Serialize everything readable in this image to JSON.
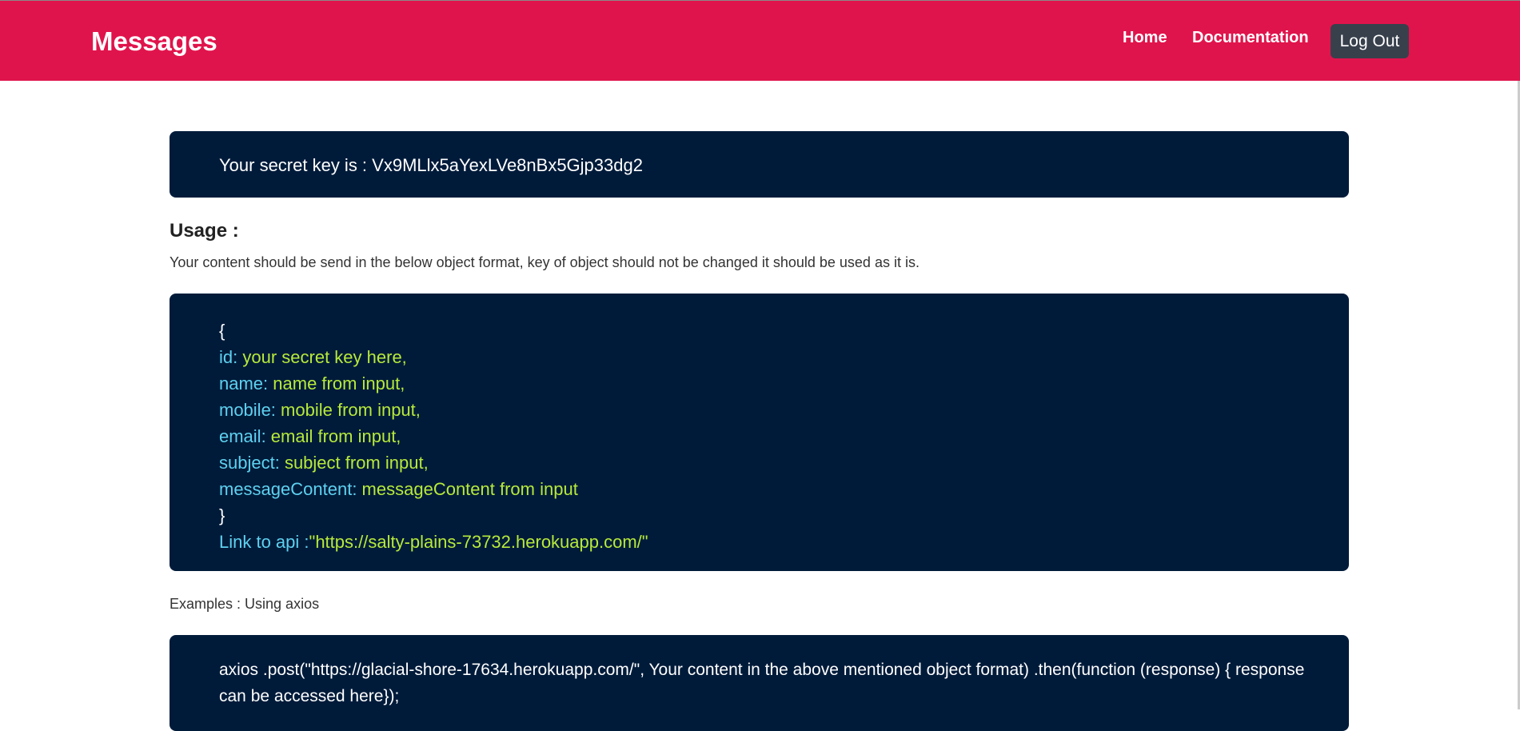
{
  "nav": {
    "brand": "Messages",
    "home": "Home",
    "documentation": "Documentation",
    "logout": "Log Out"
  },
  "secret": {
    "text": "Your secret key is : Vx9MLlx5aYexLVe8nBx5Gjp33dg2"
  },
  "usage": {
    "title": "Usage :",
    "description": "Your content should be send in the below object format, key of object should not be changed it should be used as it is."
  },
  "code": {
    "open": "{",
    "fields": [
      {
        "key": "id:",
        "value": " your secret key here,"
      },
      {
        "key": "name:",
        "value": " name from input,"
      },
      {
        "key": "mobile:",
        "value": " mobile from input,"
      },
      {
        "key": "email:",
        "value": " email from input,"
      },
      {
        "key": "subject:",
        "value": " subject from input,"
      },
      {
        "key": "messageContent:",
        "value": " messageContent from input"
      }
    ],
    "close": "}",
    "link_label": "Link to api :",
    "link_value": "\"https://salty-plains-73732.herokuapp.com/\""
  },
  "examples": {
    "title": "Examples : Using axios",
    "code": "axios .post(\"https://glacial-shore-17634.herokuapp.com/\", Your content in the above mentioned object format) .then(function (response) { response can be accessed here});"
  },
  "colors": {
    "navbar": "#e0144c",
    "card": "#001b3a",
    "key": "#5fd1f0",
    "value": "#b7ea3a",
    "logout": "#38404c"
  }
}
